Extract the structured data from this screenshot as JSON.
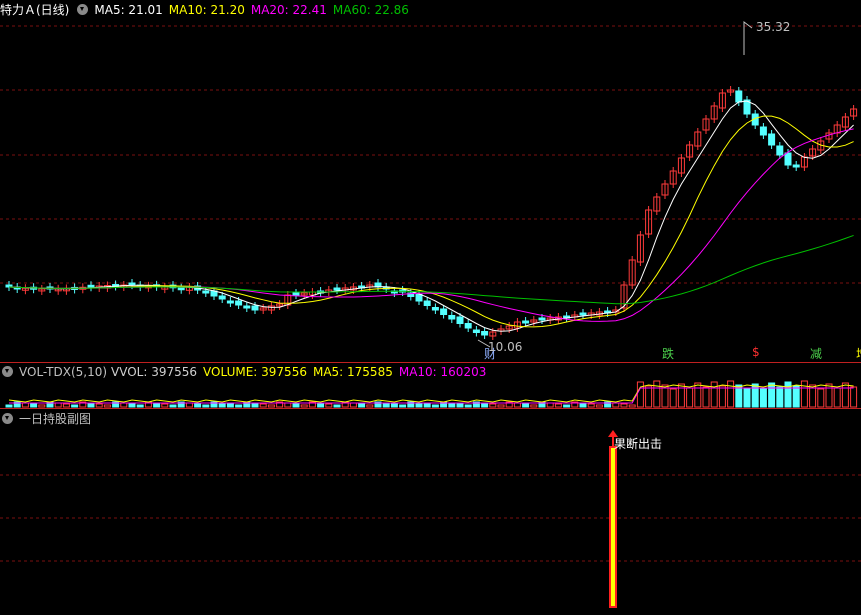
{
  "main": {
    "title": "特力Ａ(日线)",
    "ma": [
      {
        "label": "MA5: 21.01",
        "color": "#ffffff"
      },
      {
        "label": "MA10: 21.20",
        "color": "#ffff00"
      },
      {
        "label": "MA20: 22.41",
        "color": "#ff00ff"
      },
      {
        "label": "MA60: 22.86",
        "color": "#00c000"
      }
    ],
    "high_label": "35.32",
    "low_label": "10.06",
    "markers": [
      {
        "text": "财",
        "color": "#8fb0ff"
      },
      {
        "text": "跌",
        "color": "#4cd24c"
      },
      {
        "text": "$",
        "color": "#ff3030"
      },
      {
        "text": "减",
        "color": "#4cd24c"
      },
      {
        "text": "增",
        "color": "#ffff00"
      }
    ]
  },
  "vol": {
    "title": "VOL-TDX(5,10)",
    "items": [
      {
        "label": "VVOL: 397556",
        "color": "#d0d0d0"
      },
      {
        "label": "VOLUME: 397556",
        "color": "#ffff00"
      },
      {
        "label": "MA5: 175585",
        "color": "#ffff00"
      },
      {
        "label": "MA10: 160203",
        "color": "#ff00ff"
      }
    ]
  },
  "sub": {
    "title": "一日持股副图",
    "signal": "果断出击"
  },
  "colors": {
    "up": "#ff3b3b",
    "down": "#54ffff",
    "grid": "#8b1414"
  }
}
